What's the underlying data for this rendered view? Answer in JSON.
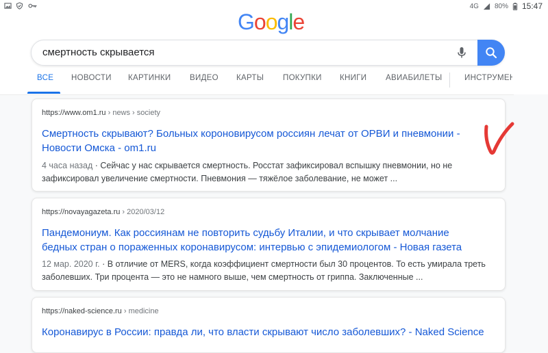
{
  "status_bar": {
    "time": "15:47",
    "battery": "80%",
    "network": "4G",
    "left_icons": [
      "gallery-icon",
      "shield-icon",
      "key-icon"
    ],
    "right_icons": [
      "network-icon",
      "signal-icon",
      "battery-icon"
    ]
  },
  "logo": {
    "letters": [
      "G",
      "o",
      "o",
      "g",
      "l",
      "e"
    ],
    "colors": [
      "#4285f4",
      "#ea4335",
      "#fbbc05",
      "#4285f4",
      "#34a853",
      "#ea4335"
    ]
  },
  "search": {
    "query": "смертность скрывается"
  },
  "tabs": [
    {
      "label": "ВСЕ",
      "active": true
    },
    {
      "label": "НОВОСТИ"
    },
    {
      "label": "КАРТИНКИ"
    },
    {
      "label": "ВИДЕО"
    },
    {
      "label": "КАРТЫ"
    },
    {
      "label": "ПОКУПКИ"
    },
    {
      "label": "КНИГИ"
    },
    {
      "label": "АВИАБИЛЕТЫ"
    },
    {
      "label": "ИНСТРУМЕН"
    }
  ],
  "results": [
    {
      "domain": "https://www.om1.ru",
      "crumb": " › news › society",
      "title": "Смертность скрывают? Больных короновирусом россиян лечат от ОРВИ и пневмонии - Новости Омска - om1.ru",
      "date": "4 часа назад",
      "snippet": " · Сейчас у нас скрывается смертность. Росстат зафиксировал вспышку пневмонии, но не зафиксировал увеличение смертности. Пневмония — тяжёлое заболевание, не может  ..."
    },
    {
      "domain": "https://novayagazeta.ru",
      "crumb": " › 2020/03/12",
      "title": "Пандемониум. Как россиянам не повторить судьбу Италии, и что скрывает молчание бедных стран о пораженных коронавирусом: интервью с эпидемиологом - Новая газета",
      "date": "12 мар. 2020 г.",
      "snippet": " · В отличие от MERS, когда коэффициент смертности был 30 процентов. То есть умирала треть заболевших. Три процента — это не намного выше, чем смертность от гриппа. Заключенные ..."
    },
    {
      "domain": "https://naked-science.ru",
      "crumb": " › medicine",
      "title": "Коронавирус в России: правда ли, что власти скрывают число заболевших? - Naked Science"
    }
  ],
  "annotation": {
    "mark": "checkmark",
    "color": "#e53935"
  }
}
